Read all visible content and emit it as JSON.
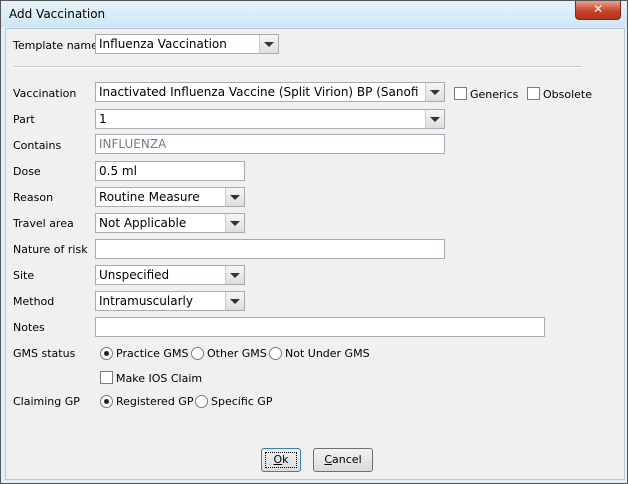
{
  "window": {
    "title": "Add Vaccination",
    "close_glyph": "✕"
  },
  "template": {
    "label": "Template name",
    "value": "Influenza Vaccination"
  },
  "vaccination": {
    "label": "Vaccination",
    "value": "Inactivated Influenza Vaccine (Split Virion) BP (Sanofi Past...",
    "generics_label": "Generics",
    "obsolete_label": "Obsolete",
    "generics_checked": false,
    "obsolete_checked": false
  },
  "part": {
    "label": "Part",
    "value": "1"
  },
  "contains": {
    "label": "Contains",
    "value": "INFLUENZA"
  },
  "dose": {
    "label": "Dose",
    "value": "0.5 ml"
  },
  "reason": {
    "label": "Reason",
    "value": "Routine Measure"
  },
  "travel_area": {
    "label": "Travel area",
    "value": "Not Applicable"
  },
  "nature_of_risk": {
    "label": "Nature of risk",
    "value": ""
  },
  "site": {
    "label": "Site",
    "value": "Unspecified"
  },
  "method": {
    "label": "Method",
    "value": "Intramuscularly"
  },
  "notes": {
    "label": "Notes",
    "value": ""
  },
  "gms_status": {
    "label": "GMS status",
    "options": [
      "Practice GMS",
      "Other GMS",
      "Not Under GMS"
    ],
    "selected": "Practice GMS"
  },
  "ios_claim": {
    "label": "Make IOS Claim",
    "checked": false
  },
  "claiming_gp": {
    "label": "Claiming GP",
    "options": [
      "Registered GP",
      "Specific GP"
    ],
    "selected": "Registered GP"
  },
  "buttons": {
    "ok_label": "Ok",
    "ok_underline": "O",
    "ok_rest": "k",
    "cancel_label": "Cancel",
    "cancel_underline": "C",
    "cancel_rest": "ancel"
  },
  "icons": {
    "close": "close-icon",
    "dropdown": "chevron-down-icon"
  }
}
